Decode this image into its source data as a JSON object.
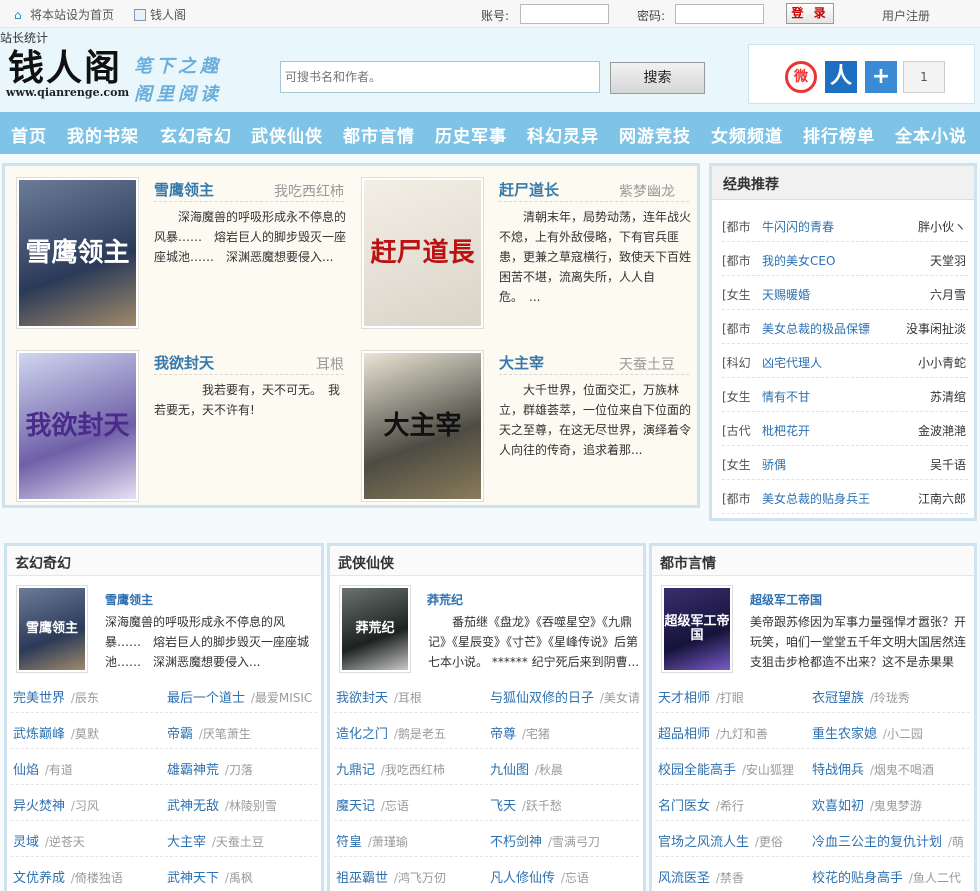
{
  "topbar": {
    "home_label": "将本站设为首页",
    "fav_label": "钱人阁",
    "account_label": "账号:",
    "password_label": "密码:",
    "login_label": "登 录",
    "register_label": "用户注册"
  },
  "header": {
    "stat_label": "站长统计",
    "logo_text": "钱人阁",
    "logo_url": "www.qianrenge.com",
    "slogan_1": "笔下之趣",
    "slogan_2": "阁里阅读",
    "search_placeholder": "可搜书名和作者。",
    "search_button": "搜索",
    "share_count": "1",
    "icons": [
      "weibo-icon",
      "renren-icon",
      "plus-share-icon"
    ]
  },
  "nav": [
    "首页",
    "我的书架",
    "玄幻奇幻",
    "武侠仙侠",
    "都市言情",
    "历史军事",
    "科幻灵异",
    "网游竞技",
    "女频频道",
    "排行榜单",
    "全本小说"
  ],
  "featured": [
    {
      "title": "雪鹰领主",
      "author": "我吃西红柿",
      "cover_text": "雪鹰领主",
      "desc": "深海魔兽的呼吸形成永不停息的风暴……　熔岩巨人的脚步毁灭一座座城池……　深渊恶魔想要侵入..."
    },
    {
      "title": "赶尸道长",
      "author": "紫梦幽龙",
      "cover_text": "赶尸道長",
      "desc": "清朝末年，局势动荡，连年战火不熄，上有外敌侵略，下有官兵匪患，更兼之草寇横行，致使天下百姓困苦不堪，流离失所，人人自危。　..."
    },
    {
      "title": "我欲封天",
      "author": "耳根",
      "cover_text": "我欲封天",
      "desc": "我若要有，天不可无。　我若要无，天不许有!"
    },
    {
      "title": "大主宰",
      "author": "天蚕土豆",
      "cover_text": "大主宰",
      "desc": "大千世界，位面交汇，万族林立，群雄荟萃，一位位来自下位面的天之至尊，在这无尽世界，演绎着令人向往的传奇，追求着那..."
    }
  ],
  "classic": {
    "title": "经典推荐",
    "items": [
      {
        "cat": "[都市",
        "name": "牛闪闪的青春",
        "author": "胖小伙ヽ"
      },
      {
        "cat": "[都市",
        "name": "我的美女CEO",
        "author": "天堂羽"
      },
      {
        "cat": "[女生",
        "name": "天赐暖婚",
        "author": "六月雪"
      },
      {
        "cat": "[都市",
        "name": "美女总裁的极品保镖",
        "author": "没事闲扯淡"
      },
      {
        "cat": "[科幻",
        "name": "凶宅代理人",
        "author": "小小青蛇"
      },
      {
        "cat": "[女生",
        "name": "情有不甘",
        "author": "苏清绾"
      },
      {
        "cat": "[古代",
        "name": "枇杷花开",
        "author": "金波滟滟"
      },
      {
        "cat": "[女生",
        "name": "骄偶",
        "author": "吴千语"
      },
      {
        "cat": "[都市",
        "name": "美女总裁的贴身兵王",
        "author": "江南六郎"
      }
    ]
  },
  "categories": [
    {
      "title": "玄幻奇幻",
      "feature": {
        "title": "雪鹰领主",
        "cover_text": "雪鹰领主",
        "desc": "深海魔兽的呼吸形成永不停息的风暴……　熔岩巨人的脚步毁灭一座座城池……　深渊恶魔想要侵入..."
      },
      "rows": [
        [
          {
            "name": "完美世界",
            "author": "辰东"
          },
          {
            "name": "最后一个道士",
            "author": "最爱MISIC"
          }
        ],
        [
          {
            "name": "武炼巅峰",
            "author": "莫默"
          },
          {
            "name": "帝霸",
            "author": "厌笔萧生"
          }
        ],
        [
          {
            "name": "仙焰",
            "author": "有道"
          },
          {
            "name": "雄霸神荒",
            "author": "刀落"
          }
        ],
        [
          {
            "name": "异火焚神",
            "author": "习风"
          },
          {
            "name": "武神无敌",
            "author": "林陵别雪"
          }
        ],
        [
          {
            "name": "灵域",
            "author": "逆苍天"
          },
          {
            "name": "大主宰",
            "author": "天蚕土豆"
          }
        ],
        [
          {
            "name": "文优养成",
            "author": "倚楼独语"
          },
          {
            "name": "武神天下",
            "author": "禹枫"
          }
        ]
      ]
    },
    {
      "title": "武侠仙侠",
      "feature": {
        "title": "莽荒纪",
        "cover_text": "莽荒纪",
        "desc": "番茄继《盘龙》《吞噬星空》《九鼎记》《星辰变》《寸芒》《星峰传说》后第七本小说。 ****** 纪宁死后来到阴曹..."
      },
      "rows": [
        [
          {
            "name": "我欲封天",
            "author": "耳根"
          },
          {
            "name": "与狐仙双修的日子",
            "author": "美女请"
          }
        ],
        [
          {
            "name": "造化之门",
            "author": "鹅是老五"
          },
          {
            "name": "帝尊",
            "author": "宅猪"
          }
        ],
        [
          {
            "name": "九鼎记",
            "author": "我吃西红柿"
          },
          {
            "name": "九仙图",
            "author": "秋晨"
          }
        ],
        [
          {
            "name": "魔天记",
            "author": "忘语"
          },
          {
            "name": "飞天",
            "author": "跃千愁"
          }
        ],
        [
          {
            "name": "符皇",
            "author": "萧瑾瑜"
          },
          {
            "name": "不朽剑神",
            "author": "雪满弓刀"
          }
        ],
        [
          {
            "name": "祖巫霸世",
            "author": "鸿飞万仞"
          },
          {
            "name": "凡人修仙传",
            "author": "忘语"
          }
        ]
      ]
    },
    {
      "title": "都市言情",
      "feature": {
        "title": "超级军工帝国",
        "cover_text": "超级军工帝国",
        "desc": "美帝跟苏修因为军事力量强悍才嚣张？开玩笑，咱们一堂堂五千年文明大国居然连支狙击步枪都造不出来？这不是赤果果地..."
      },
      "rows": [
        [
          {
            "name": "天才相师",
            "author": "打眼"
          },
          {
            "name": "衣冠望族",
            "author": "玲珑秀"
          }
        ],
        [
          {
            "name": "超品相师",
            "author": "九灯和善"
          },
          {
            "name": "重生农家媳",
            "author": "小二园"
          }
        ],
        [
          {
            "name": "校园全能高手",
            "author": "安山狐狸"
          },
          {
            "name": "特战佣兵",
            "author": "烟鬼不喝酒"
          }
        ],
        [
          {
            "name": "名门医女",
            "author": "希行"
          },
          {
            "name": "欢喜如初",
            "author": "鬼鬼梦游"
          }
        ],
        [
          {
            "name": "官场之风流人生",
            "author": "更俗"
          },
          {
            "name": "冷血三公主的复仇计划",
            "author": "萌"
          }
        ],
        [
          {
            "name": "风流医圣",
            "author": "禁香"
          },
          {
            "name": "校花的贴身高手",
            "author": "鱼人二代"
          }
        ]
      ]
    }
  ]
}
